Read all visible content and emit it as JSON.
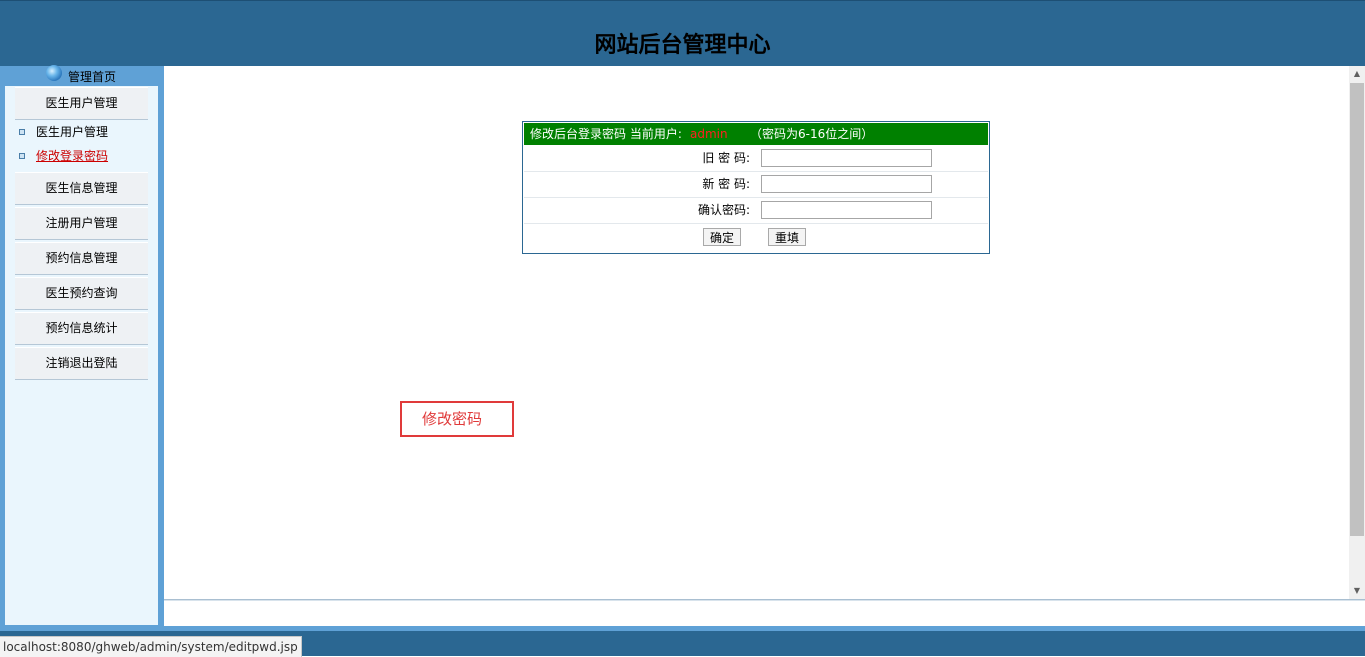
{
  "header": {
    "title": "网站后台管理中心"
  },
  "sidebar": {
    "home_label": "管理首页",
    "sections": [
      {
        "label": "医生用户管理",
        "items": [
          {
            "label": "医生用户管理",
            "active": false
          },
          {
            "label": "修改登录密码",
            "active": true
          }
        ]
      },
      {
        "label": "医生信息管理"
      },
      {
        "label": "注册用户管理"
      },
      {
        "label": "预约信息管理"
      },
      {
        "label": "医生预约查询"
      },
      {
        "label": "预约信息统计"
      },
      {
        "label": "注销退出登陆"
      }
    ]
  },
  "form": {
    "heading": "修改后台登录密码 当前用户:",
    "current_user": "admin",
    "hint": "（密码为6-16位之间）",
    "old_label": "旧 密 码:",
    "new_label": "新 密 码:",
    "confirm_label": "确认密码:",
    "old_value": "",
    "new_value": "",
    "confirm_value": "",
    "submit_label": "确定",
    "reset_label": "重填"
  },
  "annotation": {
    "label": "修改密码"
  },
  "statusbar": {
    "url": "localhost:8080/ghweb/admin/system/editpwd.jsp"
  },
  "colors": {
    "header_bg": "#2b6792",
    "frame_bg": "#5fa1d6",
    "form_head_bg": "#008000",
    "user_text": "#ff2020",
    "active_link": "#cc0000",
    "annotation": "#e03a3a"
  }
}
